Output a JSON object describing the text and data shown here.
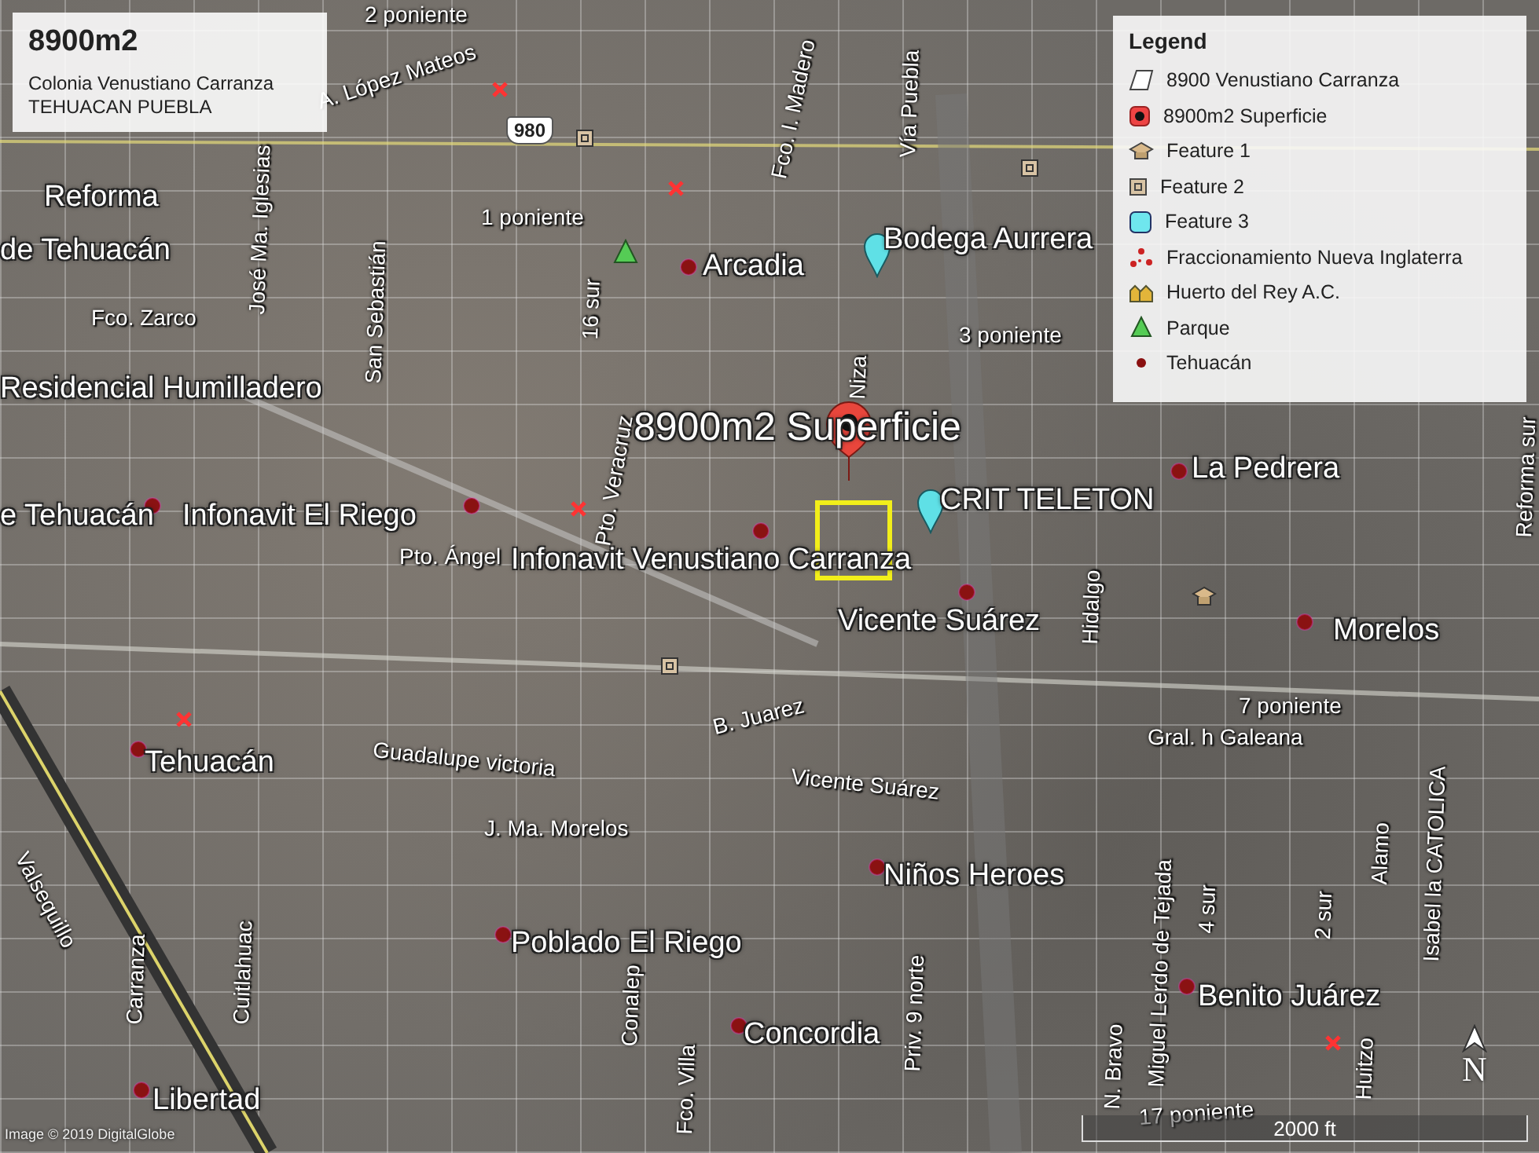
{
  "title_box": {
    "title": "8900m2",
    "lines": [
      "Colonia Venustiano Carranza",
      "TEHUACAN PUEBLA"
    ]
  },
  "legend": {
    "title": "Legend",
    "items": [
      {
        "kind": "polygon",
        "label": "8900 Venustiano Carranza"
      },
      {
        "kind": "balloon",
        "label": "8900m2 Superficie"
      },
      {
        "kind": "hat",
        "label": "Feature 1"
      },
      {
        "kind": "square",
        "label": "Feature 2"
      },
      {
        "kind": "cyan",
        "label": "Feature 3"
      },
      {
        "kind": "cluster",
        "label": "Fraccionamiento Nueva Inglaterra"
      },
      {
        "kind": "buildings",
        "label": "Huerto del Rey A.C."
      },
      {
        "kind": "tree",
        "label": "Parque"
      },
      {
        "kind": "dot",
        "label": "Tehuacán"
      }
    ]
  },
  "map": {
    "highway_shield": "980",
    "placemarks": [
      {
        "kind": "none",
        "label": "Reforma"
      },
      {
        "kind": "none",
        "label": "de Tehuacán"
      },
      {
        "kind": "dot",
        "label": "Arcadia"
      },
      {
        "kind": "teardrop",
        "label": "Bodega Aurrera"
      },
      {
        "kind": "none",
        "label": "Residencial Humilladero"
      },
      {
        "kind": "balloon",
        "label": "8900m2 Superficie"
      },
      {
        "kind": "teardrop",
        "label": "CRIT TELETON"
      },
      {
        "kind": "dot",
        "label": "La Pedrera"
      },
      {
        "kind": "dot",
        "label": "e Tehuacán"
      },
      {
        "kind": "dot",
        "label": "Infonavit El Riego"
      },
      {
        "kind": "dot",
        "label": "Infonavit Venustiano Carranza"
      },
      {
        "kind": "dot",
        "label": "Vicente Suárez"
      },
      {
        "kind": "dot",
        "label": "Morelos"
      },
      {
        "kind": "dot",
        "label": "Tehuacán"
      },
      {
        "kind": "dot",
        "label": "Niños Heroes"
      },
      {
        "kind": "dot",
        "label": "Poblado El Riego"
      },
      {
        "kind": "dot",
        "label": "Benito Juárez"
      },
      {
        "kind": "dot",
        "label": "Concordia"
      },
      {
        "kind": "dot",
        "label": "Libertad"
      }
    ],
    "street_labels": [
      "2 poniente",
      "A. López Mateos",
      "Fco. I. Madero",
      "Vía Puebla",
      "1 poniente",
      "Fco. Zarco",
      "José Ma. Iglesias",
      "San Sebastián",
      "16 sur",
      "Niza",
      "3 poniente",
      "Pto. Ángel",
      "Pto. Veracruz",
      "Hidalgo",
      "Guadalupe victoria",
      "B. Juarez",
      "Vicente Suárez",
      "J. Ma. Morelos",
      "7 poniente",
      "Gral. h Galeana",
      "Valsequillo",
      "Cuitlahuac",
      "Conalep",
      "Fco. Villa",
      "Priv. 9 norte",
      "Miguel Lerdo de Tejada",
      "N. Bravo",
      "4 sur",
      "2 sur",
      "Alamo",
      "Isabel la CATOLICA",
      "Huitzo",
      "Reforma sur",
      "Carranza",
      "17 poniente"
    ]
  },
  "scale_bar": {
    "label": "2000 ft"
  },
  "compass": {
    "label": "N"
  },
  "attribution": "Image © 2019 DigitalGlobe"
}
